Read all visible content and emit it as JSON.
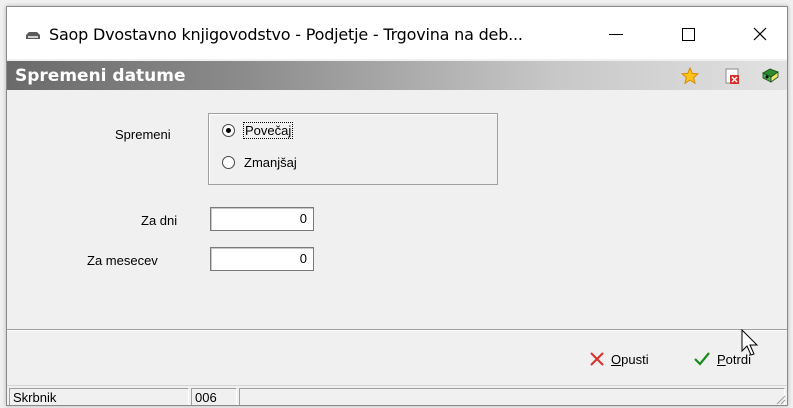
{
  "window": {
    "title": "Saop Dvostavno knjigovodstvo - Podjetje - Trgovina na deb...",
    "app_icon": "printer-icon",
    "controls": [
      "minimize-icon",
      "maximize-icon",
      "close-icon"
    ]
  },
  "form": {
    "title": "Spremeni datume",
    "toolbar_icons": [
      "star-icon",
      "close-form-icon",
      "help-book-icon"
    ],
    "spremeni_label": "Spremeni",
    "options": [
      {
        "label": "Povečaj",
        "selected": true
      },
      {
        "label": "Zmanjšaj",
        "selected": false
      }
    ],
    "za_dni_label": "Za dni",
    "za_dni_value": "0",
    "za_mesecev_label": "Za mesecev",
    "za_mesecev_value": "0"
  },
  "buttons": {
    "opusti_u": "O",
    "opusti_rest": "pusti",
    "potrdi_u": "P",
    "potrdi_rest": "otrdi"
  },
  "statusbar": {
    "user": "Skrbnik",
    "code": "006",
    "rest": ""
  },
  "colors": {
    "header_band_dark": "#6a6a6a",
    "cancel_red": "#d9302c",
    "confirm_green": "#1a8c1a"
  }
}
